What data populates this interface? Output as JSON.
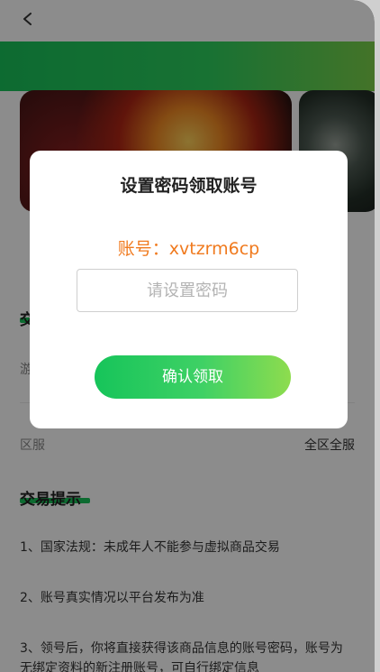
{
  "header": {
    "back_icon": "chevron-left-icon"
  },
  "colors": {
    "brand_green": "#18c45a",
    "accent_orange": "#f07a1e"
  },
  "section_trade": {
    "title": "交",
    "row_label": "游"
  },
  "region_row": {
    "label": "区服",
    "value": "全区全服"
  },
  "tips": {
    "title": "交易提示",
    "items": [
      "1、国家法规：未成年人不能参与虚拟商品交易",
      "2、账号真实情况以平台发布为准",
      "3、领号后，你将直接获得该商品信息的账号密码，账号为无绑定资料的新注册账号，可自行绑定信息"
    ]
  },
  "dialog": {
    "title": "设置密码领取账号",
    "account_label": "账号：xvtzrm6cp",
    "password_placeholder": "请设置密码",
    "confirm_label": "确认领取"
  }
}
